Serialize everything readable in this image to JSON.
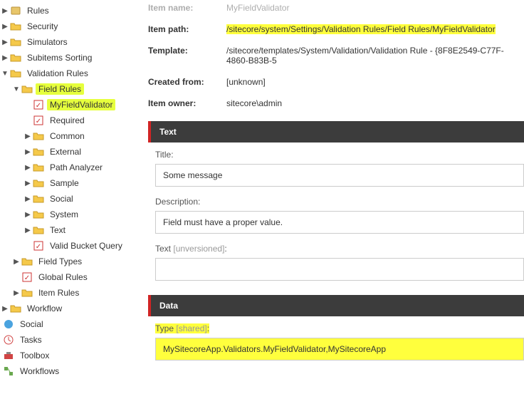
{
  "tree": {
    "rules": "Rules",
    "security": "Security",
    "simulators": "Simulators",
    "subitems_sorting": "Subitems Sorting",
    "validation_rules": "Validation Rules",
    "field_rules": "Field Rules",
    "my_field_validator": "MyFieldValidator",
    "required": "Required",
    "common": "Common",
    "external": "External",
    "path_analyzer": "Path Analyzer",
    "sample": "Sample",
    "social": "Social",
    "system": "System",
    "text": "Text",
    "valid_bucket_query": "Valid Bucket Query",
    "field_types": "Field Types",
    "global_rules": "Global Rules",
    "item_rules": "Item Rules",
    "workflow": "Workflow",
    "social_root": "Social",
    "tasks": "Tasks",
    "toolbox": "Toolbox",
    "workflows": "Workflows"
  },
  "header": {
    "item_name_label": "Item name:",
    "item_name_value": "MyFieldValidator",
    "item_path_label": "Item path:",
    "item_path_value": "/sitecore/system/Settings/Validation Rules/Field Rules/MyFieldValidator",
    "template_label": "Template:",
    "template_value": "/sitecore/templates/System/Validation/Validation Rule - {8F8E2549-C77F-4860-B83B-5",
    "created_from_label": "Created from:",
    "created_from_value": "[unknown]",
    "item_owner_label": "Item owner:",
    "item_owner_value": "sitecore\\admin"
  },
  "sections": {
    "text": "Text",
    "data": "Data"
  },
  "form": {
    "title_label": "Title:",
    "title_value": "Some message",
    "description_label": "Description:",
    "description_value": "Field must have a proper value.",
    "text_label": "Text",
    "text_hint": "[unversioned]",
    "text_value": "",
    "type_label": "Type",
    "type_hint": "[shared]",
    "type_value": "MySitecoreApp.Validators.MyFieldValidator,MySitecoreApp"
  }
}
